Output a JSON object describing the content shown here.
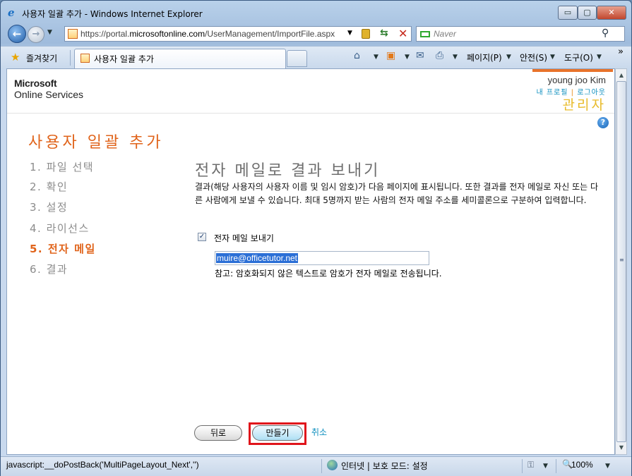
{
  "window": {
    "title": "사용자 일괄 추가 - Windows Internet Explorer",
    "minimize_glyph": "▭",
    "maximize_glyph": "▢",
    "close_glyph": "✕"
  },
  "address_bar": {
    "url_prefix": "https://portal.",
    "url_domain": "microsoftonline.com",
    "url_path": "/UserManagement/ImportFile.aspx"
  },
  "search": {
    "placeholder": "Naver"
  },
  "favorites": {
    "label": "즐겨찾기"
  },
  "tab": {
    "label": "사용자 일괄 추가"
  },
  "toolbar": {
    "page_label": "페이지(P)",
    "safety_label": "안전(S)",
    "tools_label": "도구(O)",
    "more_glyph": "»"
  },
  "header": {
    "logo_line1": "Microsoft",
    "logo_line2": "Online Services",
    "user_name": "young joo Kim",
    "profile_link": "내 프로필",
    "link_separator": "|",
    "logout_link": "로그아웃",
    "role": "관리자"
  },
  "page": {
    "title": "사용자 일괄 추가",
    "steps": [
      {
        "label": "1. 파일 선택",
        "active": false
      },
      {
        "label": "2. 확인",
        "active": false
      },
      {
        "label": "3. 설정",
        "active": false
      },
      {
        "label": "4. 라이선스",
        "active": false
      },
      {
        "label": "5. 전자 메일",
        "active": true
      },
      {
        "label": "6. 결과",
        "active": false
      }
    ],
    "section_title": "전자 메일로 결과 보내기",
    "description": "결과(해당 사용자의 사용자 이름 및 임시 암호)가 다음 페이지에 표시됩니다. 또한 결과를 전자 메일로 자신 또는 다른 사람에게 보낼 수 있습니다. 최대 5명까지 받는 사람의 전자 메일 주소를 세미콜론으로 구분하여 입력합니다.",
    "send_email_checkbox": {
      "label": "전자 메일 보내기",
      "checked": true,
      "mark": "✓"
    },
    "email_value": "muire@officetutor.net",
    "note": "참고: 암호화되지 않은 텍스트로 암호가 전자 메일로 전송됩니다.",
    "back_button": "뒤로",
    "create_button": "만들기",
    "cancel_link": "취소"
  },
  "statusbar": {
    "text": "javascript:__doPostBack('MultiPageLayout_Next','')",
    "zone": "인터넷 | 보호 모드: 설정",
    "zoom": "100%"
  },
  "colors": {
    "accent_orange": "#e0631a",
    "link_blue": "#0e8fbf",
    "highlight_red": "#e0141b"
  }
}
